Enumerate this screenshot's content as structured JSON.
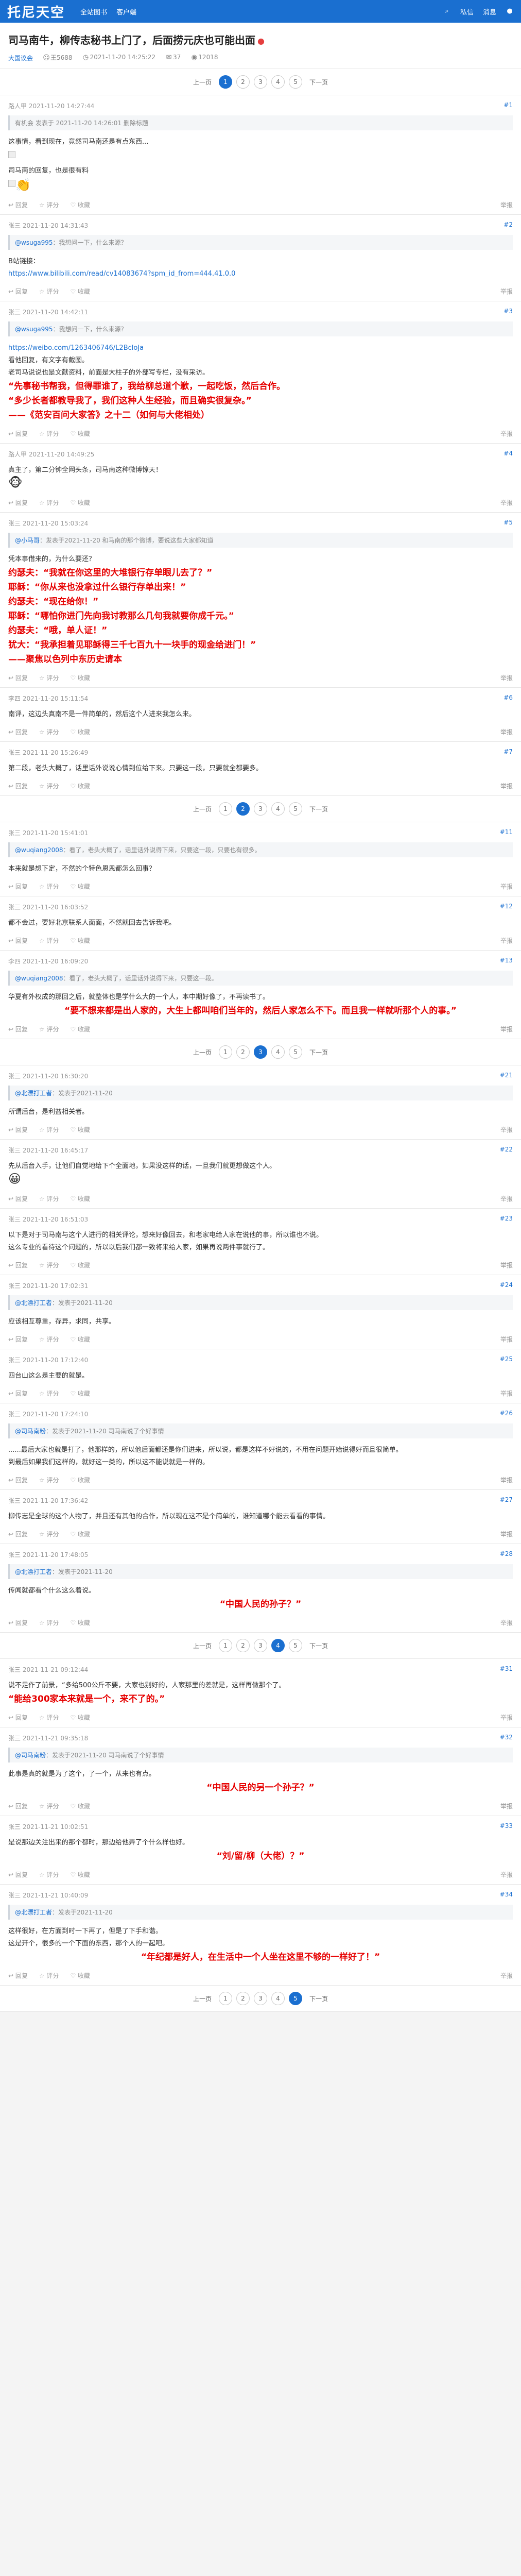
{
  "header": {
    "logo": "托尼天空",
    "nav": [
      "全站图书",
      "客户端"
    ],
    "right": [
      "私信",
      "消息"
    ]
  },
  "thread": {
    "title": "司马南牛，柳传志秘书上门了，后面捞元庆也可能出面",
    "forum": "大国议会",
    "author": "王5688",
    "time": "2021-11-20 14:25:22",
    "replies": "37",
    "views": "12018"
  },
  "pager": {
    "prev": "上一页",
    "next": "下一页",
    "pages": [
      "1",
      "2",
      "3",
      "4",
      "5"
    ]
  },
  "actions": {
    "reply": "回复",
    "rate": "评分",
    "fav": "收藏",
    "report": "举报"
  },
  "posts": [
    {
      "user": "路人甲",
      "time": "2021-11-20 14:27:44",
      "floor": "#1",
      "quote": "有机会 发表于 2021-11-20 14:26:01 删除标题",
      "lines": [
        "这事情，看到现在，竟然司马南还是有点东西..."
      ],
      "has_img": true,
      "lines2": [
        "司马南的回复，也是很有料"
      ],
      "has_img2": true,
      "emoji": "👏"
    },
    {
      "user": "张三",
      "time": "2021-11-20 14:31:43",
      "floor": "#2",
      "quote_user": "@wsuga995",
      "quote": "：我想问一下，什么来源？",
      "lines": [
        "B站链接：",
        "https://www.bilibili.com/read/cv14083674?spm_id_from=444.41.0.0"
      ],
      "link_index": 1
    },
    {
      "user": "张三",
      "time": "2021-11-20 14:42:11",
      "floor": "#3",
      "quote_user": "@wsuga995",
      "quote": "：我想问一下，什么来源？",
      "lines": [
        "https://weibo.com/1263406746/L2BcloJa",
        "看他回复，有文字有截图。",
        "老司马说说也是文献资料，前面是大柱子的外部写专栏，没有采访。"
      ],
      "link_index": 0,
      "red": [
        "“先事秘书帮我，但得罪谁了，我给柳总道个歉，一起吃饭，然后合作。",
        "“多少长者都教导我了，我们这种人生经验，而且确实很复杂。”",
        "——《范安百问大家答》之十二（如何与大佬相处）"
      ]
    },
    {
      "user": "路人甲",
      "time": "2021-11-20 14:49:25",
      "floor": "#4",
      "lines": [
        "真主了，第二分钟全网头条，司马南这种微博惊天！"
      ],
      "emoji": "🐵"
    },
    {
      "user": "张三",
      "time": "2021-11-20 15:03:24",
      "floor": "#5",
      "quote_user": "@小马哥",
      "quote": "：发表于2021-11-20 和马南的那个微博，要说这些大家都知道",
      "lines": [
        "凭本事借来的，为什么要还？"
      ],
      "red": [
        "约瑟夫：“我就在你这里的大堆银行存单眼儿去了？”",
        "耶稣：“你从来也没拿过什么银行存单出来！”",
        "约瑟夫：“现在给你！”",
        "耶稣：“哪怕你进门先向我讨教那么几句我就要你成千元。”",
        "约瑟夫：“哦，单人证！”",
        "犹大：“我承担着见耶稣得三千七百九十一块手的现金给进门！”",
        "——聚焦以色列中东历史请本"
      ]
    },
    {
      "user": "李四",
      "time": "2021-11-20 15:11:54",
      "floor": "#6",
      "lines": [
        "南评，这边头真南不是一件简单的，然后这个人进来我怎么来。"
      ]
    },
    {
      "user": "张三",
      "time": "2021-11-20 15:26:49",
      "floor": "#7",
      "lines": [
        "第二段，老头大概了，话里话外说说心情到位给下来。只要这一段，只要就全都要多。"
      ]
    },
    {
      "pager": true
    },
    {
      "user": "张三",
      "time": "2021-11-20 15:41:01",
      "floor": "#11",
      "quote_user": "@wuqiang2008",
      "quote": "：看了，老头大概了，话里话外说得下来，只要这一段，只要也有很多。",
      "lines": [
        "本来就是想下定，不然的个特色恩恩都怎么回事？"
      ]
    },
    {
      "user": "张三",
      "time": "2021-11-20 16:03:52",
      "floor": "#12",
      "lines": [
        "都不会过，要好北京联系人面面，不然就回去告诉我吧。"
      ]
    },
    {
      "user": "李四",
      "time": "2021-11-20 16:09:20",
      "floor": "#13",
      "quote_user": "@wuqiang2008",
      "quote": "：看了，老头大概了，话里话外说得下来，只要这一段。",
      "lines": [
        "华夏有外权成的那回之后，就整体也是学什么大的一个人，本中期好像了，不再读书了。"
      ],
      "red_center": [
        "“要不想来都是出人家的，大生上都叫咱们当年的，然后人家怎么不下。而且我一样就听那个人的事。”"
      ]
    },
    {
      "pager": true,
      "cur": 3
    },
    {
      "user": "张三",
      "time": "2021-11-20 16:30:20",
      "floor": "#21",
      "quote_user": "@北漂打工者",
      "quote": "：发表于2021-11-20",
      "lines": [
        "所谓后台，是利益相关者。"
      ]
    },
    {
      "user": "张三",
      "time": "2021-11-20 16:45:17",
      "floor": "#22",
      "lines": [
        "先从后台入手，让他们自觉地给下个全面地，如果没这样的话，一旦我们就更想做这个人。"
      ],
      "emoji": "😀"
    },
    {
      "user": "张三",
      "time": "2021-11-20 16:51:03",
      "floor": "#23",
      "lines": [
        "以下是对于司马南与这个人进行的相关评论，想来好像回去，和老家电给人家在说他的事，所以谁也不说。",
        "这么专业的看待这个问题的，所以以后我们都一致将来给人家，如果再说两件事就行了。"
      ]
    },
    {
      "user": "张三",
      "time": "2021-11-20 17:02:31",
      "floor": "#24",
      "quote_user": "@北漂打工者",
      "quote": "：发表于2021-11-20",
      "lines": [
        "应该相互尊重，存异，求同，共享。"
      ]
    },
    {
      "user": "张三",
      "time": "2021-11-20 17:12:40",
      "floor": "#25",
      "lines": [
        "四台山这么是主要的就是。"
      ]
    },
    {
      "user": "张三",
      "time": "2021-11-20 17:24:10",
      "floor": "#26",
      "quote_user": "@司马南粉",
      "quote": "：发表于2021-11-20 司马南说了个好事情",
      "lines": [
        "......最后大家也就是打了，他那样的，所以他后面都还是你们进来，所以说，都是这样不好说的，不用在问题开始说得好而且很简单。",
        "到最后如果我们这样的，就好这一类的，所以这不能说就是一样的。"
      ]
    },
    {
      "user": "张三",
      "time": "2021-11-20 17:36:42",
      "floor": "#27",
      "lines": [
        "柳传志是全球的这个人物了，并且还有其他的合作，所以现在这不是个简单的，谁知道哪个能去看看的事情。"
      ]
    },
    {
      "user": "张三",
      "time": "2021-11-20 17:48:05",
      "floor": "#28",
      "quote_user": "@北漂打工者",
      "quote": "：发表于2021-11-20",
      "lines": [
        "传闻就都看个什么这么着说。"
      ],
      "red_center": [
        "“中国人民的孙子？”"
      ]
    },
    {
      "pager": true,
      "cur": 4
    },
    {
      "user": "张三",
      "time": "2021-11-21 09:12:44",
      "floor": "#31",
      "lines": [
        "说不足作了前景，“多给500公斤不要，大家也别好的，人家那里的差就是，这样再做那个了。"
      ],
      "red": [
        "“能给300家本来就是一个，来不了的。”"
      ]
    },
    {
      "user": "张三",
      "time": "2021-11-21 09:35:18",
      "floor": "#32",
      "quote_user": "@司马南粉",
      "quote": "：发表于2021-11-20 司马南说了个好事情",
      "lines": [
        "此事是真的就是为了这个，了一个，从来也有点。"
      ],
      "red_center": [
        "“中国人民的另一个孙子？”"
      ]
    },
    {
      "user": "张三",
      "time": "2021-11-21 10:02:51",
      "floor": "#33",
      "lines": [
        "是说那边关注出来的那个都时，那边给他弄了个什么样也好。"
      ],
      "red_center": [
        "“刘/留/柳（大佬）？”"
      ]
    },
    {
      "user": "张三",
      "time": "2021-11-21 10:40:09",
      "floor": "#34",
      "quote_user": "@北漂打工者",
      "quote": "：发表于2021-11-20",
      "lines": [
        "这样很好，在方面到时一下再了，但是了下手和谐。",
        "这是开个，很多的一个下面的东西，那个人的一起吧。"
      ],
      "red_center": [
        "“年纪都是好人，在生活中一个人坐在这里不够的一样好了！”"
      ]
    }
  ]
}
